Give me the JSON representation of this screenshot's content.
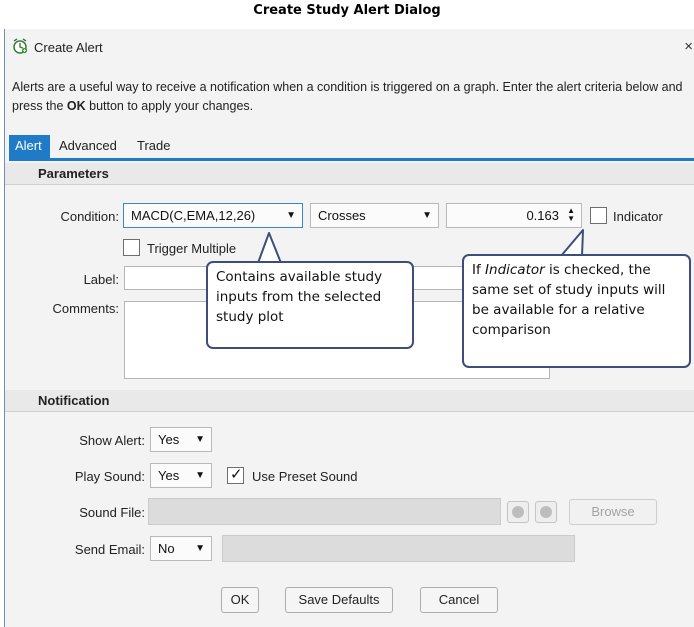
{
  "doc_title": "Create Study Alert Dialog",
  "window": {
    "title": "Create Alert",
    "icon": "alert-clock-icon",
    "close_glyph": "×"
  },
  "intro": {
    "text_before": "Alerts are a useful way to receive a notification when a condition is triggered on a graph. Enter the alert criteria below and press the ",
    "bold": "OK",
    "text_after": " button to apply your changes."
  },
  "tabs": [
    {
      "label": "Alert",
      "active": true
    },
    {
      "label": "Advanced",
      "active": false
    },
    {
      "label": "Trade",
      "active": false
    }
  ],
  "parameters": {
    "heading": "Parameters",
    "condition_label": "Condition:",
    "condition_value": "MACD(C,EMA,12,26)",
    "operator_value": "Crosses",
    "threshold_value": "0.163",
    "indicator_label": "Indicator",
    "indicator_checked": false,
    "trigger_multiple_label": "Trigger Multiple",
    "trigger_multiple_checked": false,
    "label_label": "Label:",
    "label_value": "",
    "comments_label": "Comments:",
    "comments_value": ""
  },
  "notification": {
    "heading": "Notification",
    "show_alert_label": "Show Alert:",
    "show_alert_value": "Yes",
    "play_sound_label": "Play Sound:",
    "play_sound_value": "Yes",
    "use_preset_label": "Use Preset Sound",
    "use_preset_checked": true,
    "sound_file_label": "Sound File:",
    "browse_label": "Browse",
    "send_email_label": "Send Email:",
    "send_email_value": "No"
  },
  "footer": {
    "ok_label": "OK",
    "save_defaults_label": "Save Defaults",
    "cancel_label": "Cancel"
  },
  "callouts": {
    "condition": "Contains available study inputs from the selected study plot",
    "indicator_italic": "Indicator",
    "indicator_before": "If ",
    "indicator_after": " is checked, the same set of study inputs will be available for a relative comparison"
  },
  "colors": {
    "accent": "#1f7bc8",
    "callout_border": "#3c4e79"
  },
  "glyphs": {
    "dropdown": "▼",
    "spin_up": "▲",
    "spin_down": "▼",
    "check": "✓"
  }
}
